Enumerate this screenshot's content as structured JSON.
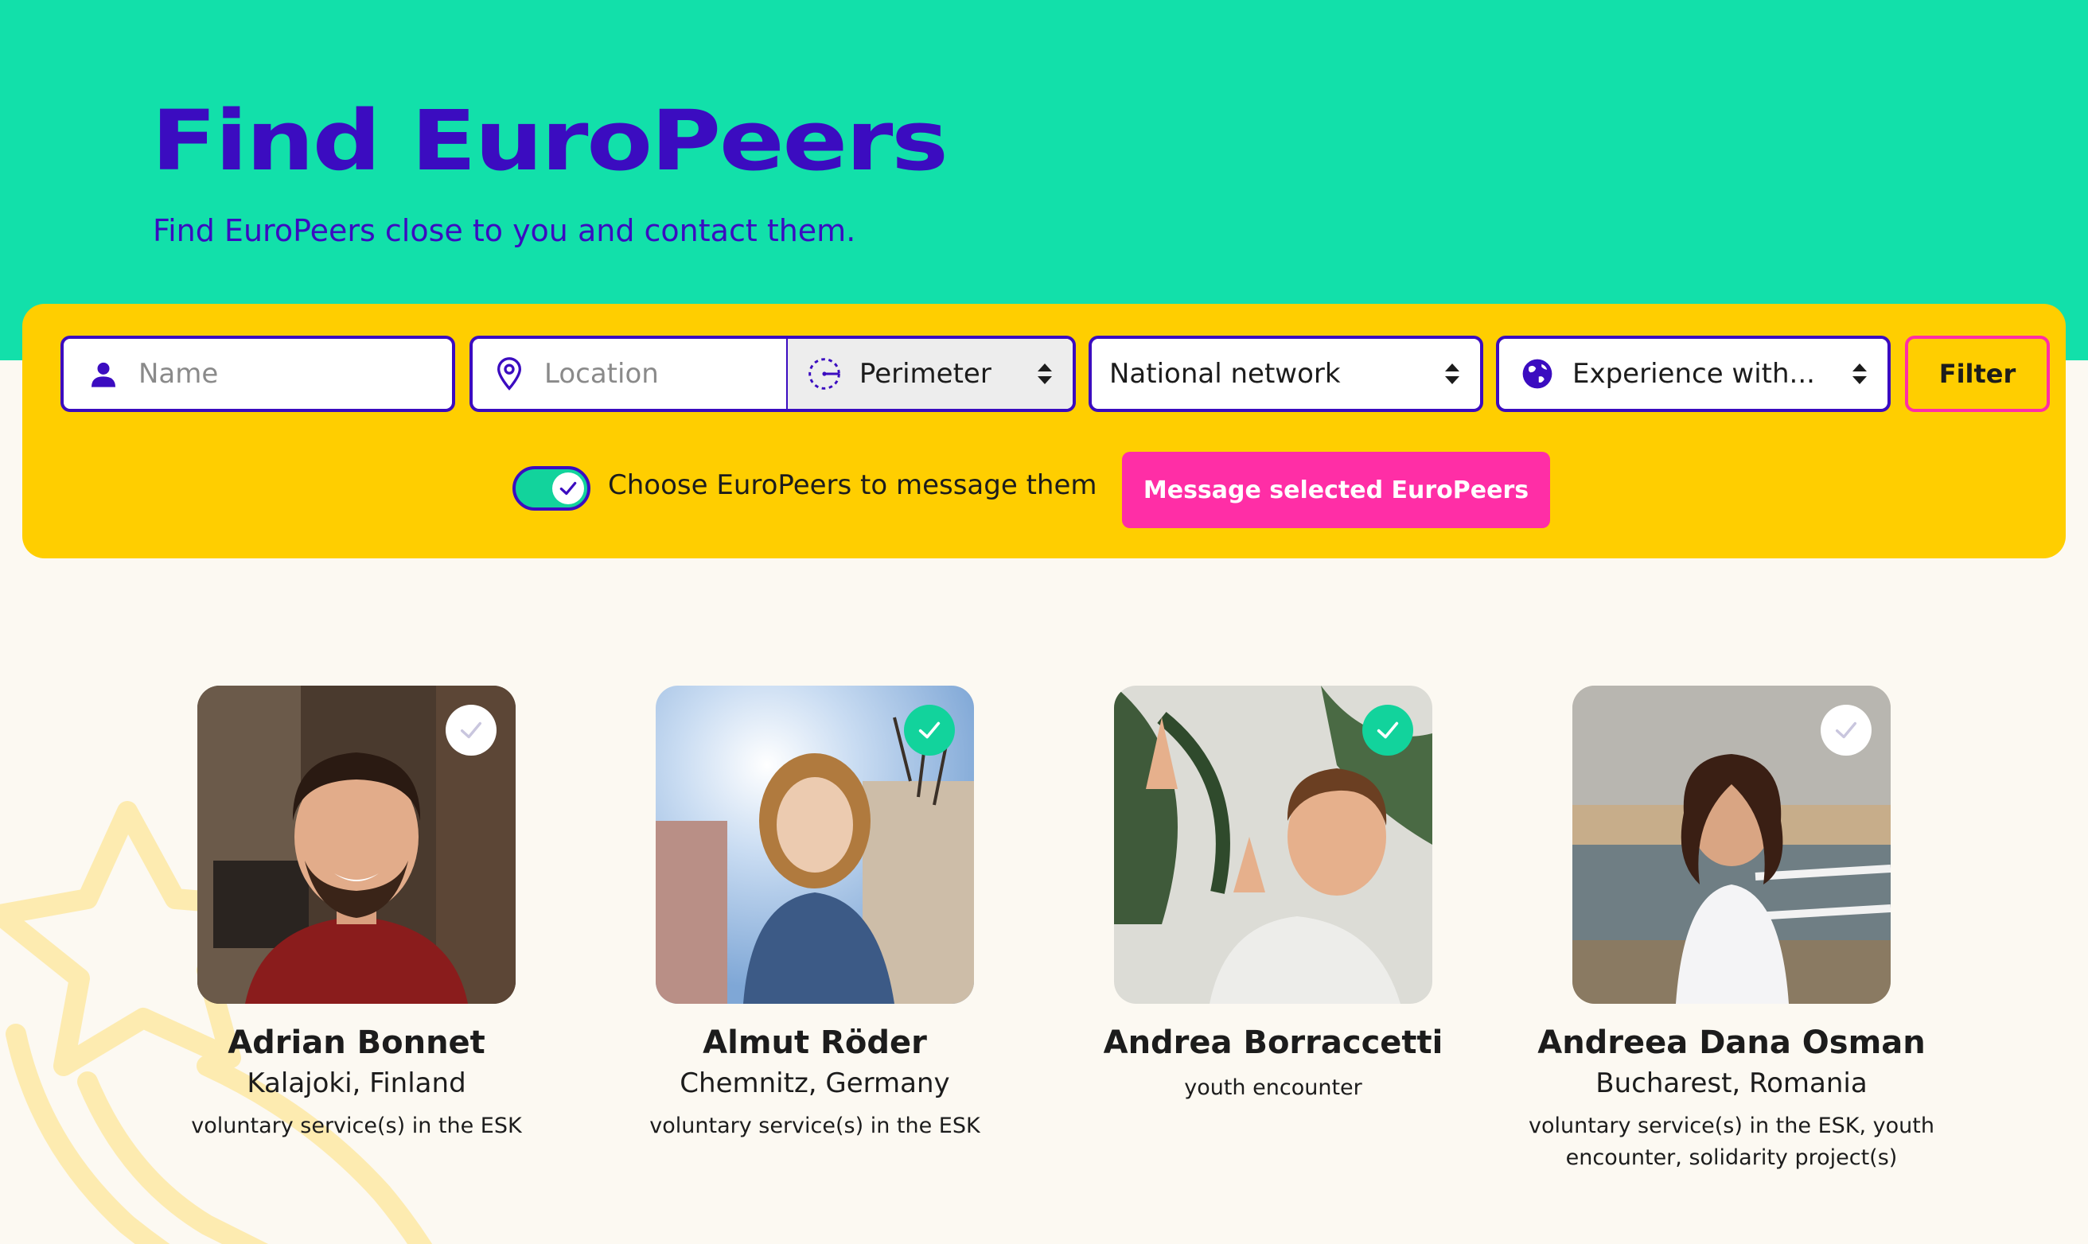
{
  "header": {
    "title": "Find EuroPeers",
    "subtitle": "Find EuroPeers close to you and contact them."
  },
  "filters": {
    "name_placeholder": "Name",
    "location_placeholder": "Location",
    "perimeter_label": "Perimeter",
    "network_label": "National network",
    "experience_label": "Experience with...",
    "filter_button": "Filter"
  },
  "selection": {
    "toggle_label": "Choose EuroPeers to message them",
    "toggle_on": true,
    "message_button": "Message selected EuroPeers"
  },
  "colors": {
    "hero": "#12E0AA",
    "accent_purple": "#3B0CC0",
    "panel_yellow": "#FFCE00",
    "pink": "#FF2EA6",
    "check_green": "#12D39C"
  },
  "peers": [
    {
      "name": "Adrian Bonnet",
      "location": "Kalajoki, Finland",
      "experience": "voluntary service(s) in the ESK",
      "selected": false
    },
    {
      "name": "Almut Röder",
      "location": "Chemnitz, Germany",
      "experience": "voluntary service(s) in the ESK",
      "selected": true
    },
    {
      "name": "Andrea Borraccetti",
      "location": "",
      "experience": "youth encounter",
      "selected": true
    },
    {
      "name": "Andreea Dana Osman",
      "location": "Bucharest, Romania",
      "experience": "voluntary service(s) in the ESK, youth encounter, solidarity project(s)",
      "selected": false
    }
  ]
}
